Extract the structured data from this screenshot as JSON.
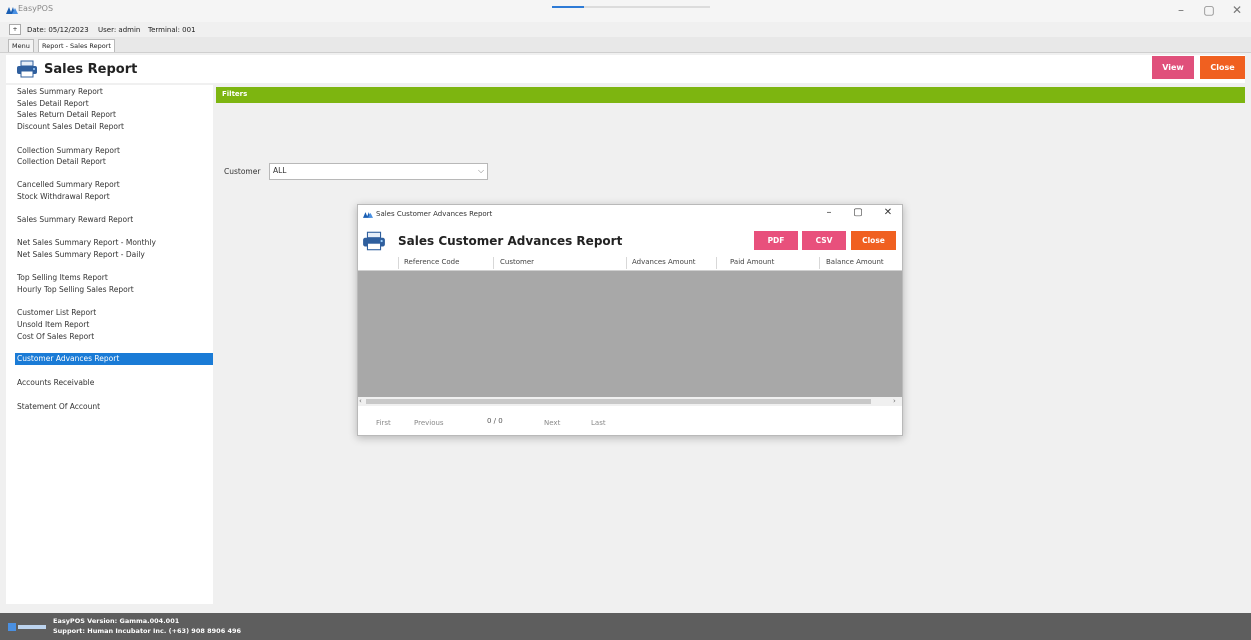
{
  "window": {
    "title": "EasyPOS",
    "controls": [
      "–",
      "▢",
      "✕"
    ]
  },
  "info": {
    "toggle": "+",
    "date": "Date: 05/12/2023",
    "user": "User: admin",
    "terminal": "Terminal: 001"
  },
  "tabs": [
    "Menu",
    "Report - Sales Report"
  ],
  "header": {
    "title": "Sales Report",
    "view_label": "View",
    "close_label": "Close"
  },
  "sidebar": {
    "selected_index": 16,
    "items": [
      "Sales Summary Report",
      "Sales Detail Report",
      "Sales Return Detail Report",
      "Discount Sales Detail Report",
      "Collection Summary Report",
      "Collection Detail Report",
      "Cancelled Summary Report",
      "Stock Withdrawal Report",
      "Sales Summary Reward Report",
      "Net Sales Summary Report - Monthly",
      "Net Sales Summary Report - Daily",
      "Top Selling Items Report",
      "Hourly Top Selling Sales Report",
      "Customer List Report",
      "Unsold Item Report",
      "Cost Of Sales Report",
      "Customer Advances Report",
      "Accounts Receivable",
      "Statement Of Account"
    ]
  },
  "filters": {
    "bar_label": "Filters",
    "customer_label": "Customer",
    "customer_value": "ALL"
  },
  "dialog": {
    "window_title": "Sales Customer Advances Report",
    "heading": "Sales Customer Advances Report",
    "pdf_label": "PDF",
    "csv_label": "CSV",
    "close_label": "Close",
    "columns": [
      "Reference Code",
      "Customer",
      "Advances Amount",
      "Paid Amount",
      "Balance Amount"
    ],
    "rows": [],
    "pager": {
      "first": "First",
      "previous": "Previous",
      "page_info": "0 / 0",
      "next": "Next",
      "last": "Last"
    }
  },
  "footer": {
    "version": "EasyPOS Version: Gamma.004.001",
    "support": "Support: Human Incubator Inc. (+63) 908 8906 496"
  },
  "colors": {
    "accent_pink": "#e0507b",
    "accent_orange": "#f06020",
    "filters_green": "#7db510",
    "selection_blue": "#1a7bd6"
  }
}
